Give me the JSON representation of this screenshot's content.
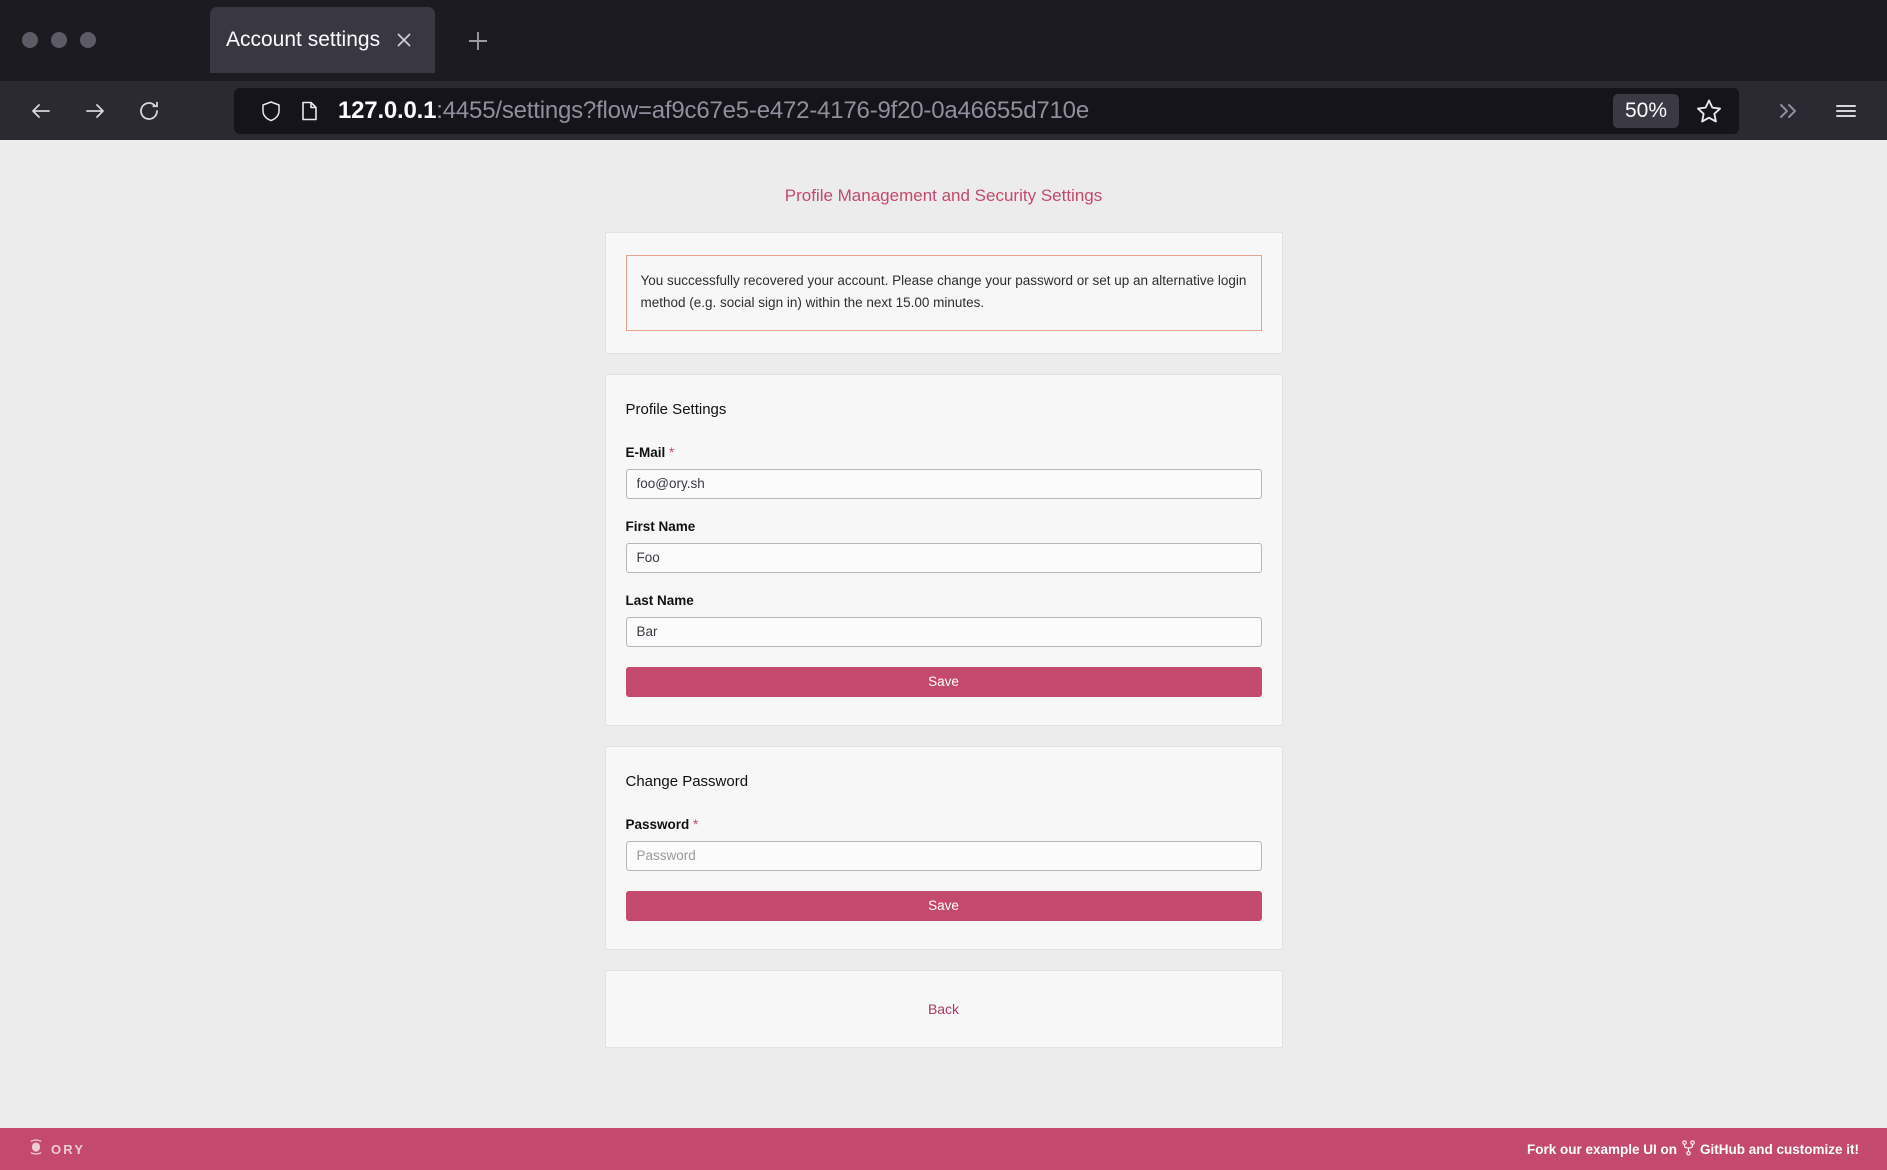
{
  "browser": {
    "window_controls": [
      "minimize-dot",
      "maximize-dot",
      "close-dot"
    ],
    "tab": {
      "title": "Account settings",
      "close_icon": "close-icon"
    },
    "new_tab_icon": "plus-icon",
    "nav": {
      "back_icon": "arrow-left-icon",
      "forward_icon": "arrow-right-icon",
      "reload_icon": "reload-icon"
    },
    "address_bar": {
      "shield_icon": "shield-icon",
      "page_icon": "page-icon",
      "url_host": "127.0.0.1",
      "url_rest": ":4455/settings?flow=af9c67e5-e472-4176-9f20-0a46655d710e",
      "zoom_level": "50%",
      "bookmark_icon": "star-icon"
    },
    "overflow_icon": "chevron-double-right-icon",
    "menu_icon": "hamburger-menu-icon"
  },
  "page": {
    "title": "Profile Management and Security Settings",
    "alert": {
      "message": "You successfully recovered your account. Please change your password or set up an alternative login method (e.g. social sign in) within the next 15.00 minutes."
    },
    "profile_settings": {
      "heading": "Profile Settings",
      "fields": [
        {
          "label": "E-Mail",
          "required": "*",
          "value": "foo@ory.sh",
          "placeholder": ""
        },
        {
          "label": "First Name",
          "required": "",
          "value": "Foo",
          "placeholder": ""
        },
        {
          "label": "Last Name",
          "required": "",
          "value": "Bar",
          "placeholder": ""
        }
      ],
      "save_label": "Save"
    },
    "change_password": {
      "heading": "Change Password",
      "field": {
        "label": "Password",
        "required": "*",
        "value": "",
        "placeholder": "Password"
      },
      "save_label": "Save"
    },
    "back_label": "Back"
  },
  "footer": {
    "logo_text": "ORY",
    "logo_mark": "ory-logo-icon",
    "fork_icon": "git-fork-icon",
    "text_before": "Fork our example UI on",
    "text_after": "GitHub and customize it!"
  },
  "colors": {
    "accent": "#c4496e",
    "accent_dark": "#a93a5f",
    "alert_border": "#e8a28e",
    "page_bg": "#ececec",
    "card_bg": "#f7f7f7",
    "chrome_bg": "#1c1b22",
    "navbar_bg": "#2b2a33",
    "urlbar_bg": "#15141a"
  }
}
